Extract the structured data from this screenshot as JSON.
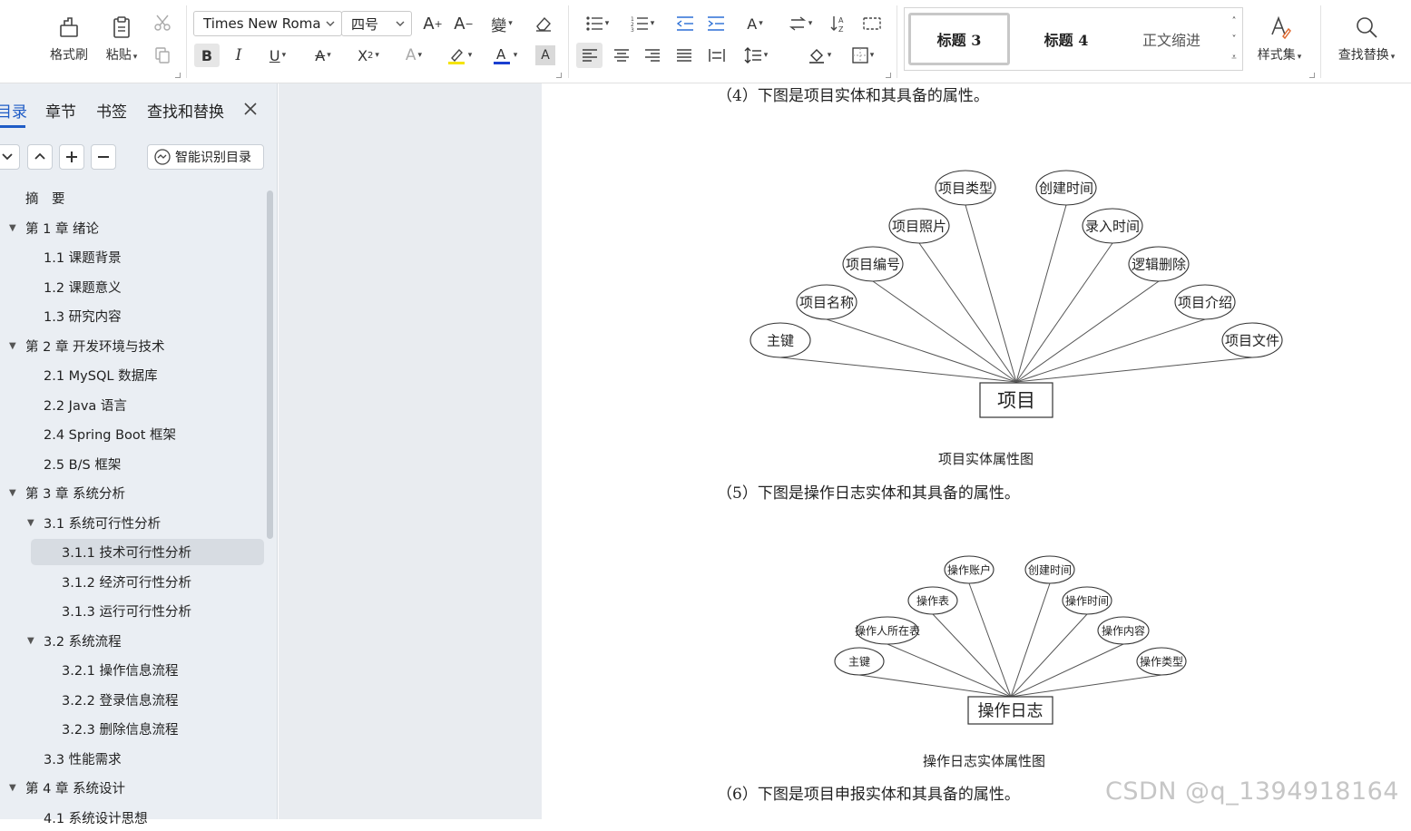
{
  "ribbon": {
    "format_painter": "格式刷",
    "paste": "粘贴",
    "font_name": "Times New Roman",
    "font_size": "四号",
    "styles": [
      "标题 3",
      "标题 4",
      "正文缩进"
    ],
    "style_set": "样式集",
    "find_replace": "查找替换",
    "accent_color": "#2b6fd6",
    "highlight_color": "#f5e400",
    "font_color": "#1a3fd0"
  },
  "sidebar": {
    "tabs": [
      "目录",
      "章节",
      "书签",
      "查找和替换"
    ],
    "smart_toc": "智能识别目录",
    "toc": [
      {
        "label": "摘　要",
        "level": 0
      },
      {
        "label": "第 1 章  绪论",
        "level": 0,
        "expanded": true
      },
      {
        "label": "1.1  课题背景",
        "level": 1
      },
      {
        "label": "1.2  课题意义",
        "level": 1
      },
      {
        "label": "1.3  研究内容",
        "level": 1
      },
      {
        "label": "第 2 章  开发环境与技术",
        "level": 0,
        "expanded": true
      },
      {
        "label": "2.1 MySQL 数据库",
        "level": 1
      },
      {
        "label": "2.2 Java 语言",
        "level": 1
      },
      {
        "label": "2.4 Spring Boot 框架",
        "level": 1
      },
      {
        "label": "2.5 B/S 框架",
        "level": 1
      },
      {
        "label": "第 3 章  系统分析",
        "level": 0,
        "expanded": true
      },
      {
        "label": "3.1  系统可行性分析",
        "level": 1,
        "expanded": true
      },
      {
        "label": "3.1.1 技术可行性分析",
        "level": 2,
        "selected": true
      },
      {
        "label": "3.1.2 经济可行性分析",
        "level": 2
      },
      {
        "label": "3.1.3 运行可行性分析",
        "level": 2
      },
      {
        "label": "3.2  系统流程",
        "level": 1,
        "expanded": true
      },
      {
        "label": "3.2.1  操作信息流程",
        "level": 2
      },
      {
        "label": "3.2.2  登录信息流程",
        "level": 2
      },
      {
        "label": "3.2.3  删除信息流程",
        "level": 2
      },
      {
        "label": "3.3  性能需求",
        "level": 1
      },
      {
        "label": "第 4 章  系统设计",
        "level": 0,
        "expanded": true
      },
      {
        "label": "4.1  系统设计思想",
        "level": 1
      }
    ]
  },
  "document": {
    "para4": "（4）下图是项目实体和其具备的属性。",
    "diagram1": {
      "entity": "项目",
      "attributes": [
        "主键",
        "项目名称",
        "项目编号",
        "项目照片",
        "项目类型",
        "创建时间",
        "录入时间",
        "逻辑删除",
        "项目介绍",
        "项目文件"
      ],
      "caption": "项目实体属性图"
    },
    "para5": "（5）下图是操作日志实体和其具备的属性。",
    "diagram2": {
      "entity": "操作日志",
      "attributes": [
        "主键",
        "操作人所在表",
        "操作表",
        "操作账户",
        "创建时间",
        "操作时间",
        "操作内容",
        "操作类型"
      ],
      "caption": "操作日志实体属性图"
    },
    "para6": "（6）下图是项目申报实体和其具备的属性。",
    "watermark": "CSDN @q_1394918164"
  }
}
